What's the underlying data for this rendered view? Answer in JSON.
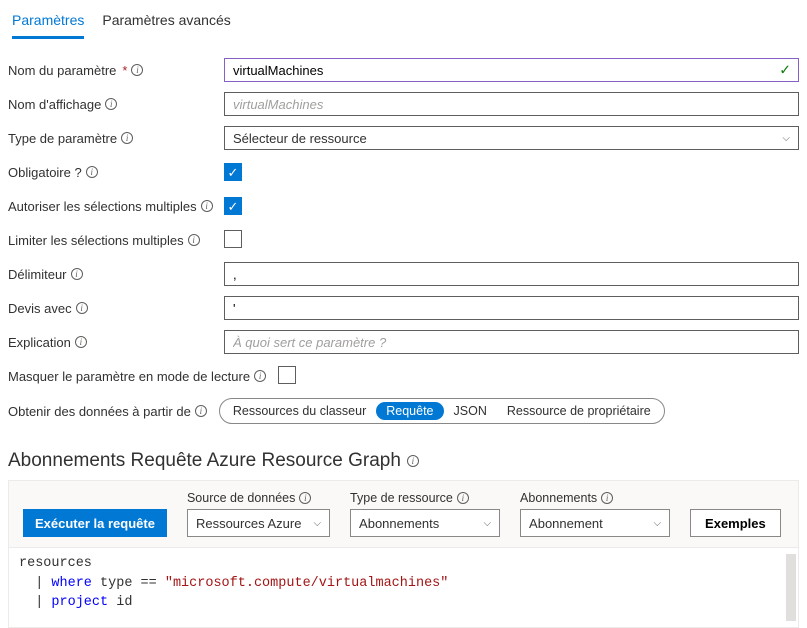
{
  "tabs": {
    "params": "Paramètres",
    "advanced": "Paramètres avancés"
  },
  "labels": {
    "param_name": "Nom du paramètre",
    "display_name": "Nom d'affichage",
    "param_type": "Type de paramètre",
    "required": "Obligatoire ?",
    "allow_multi": "Autoriser les sélections multiples",
    "limit_multi": "Limiter les sélections multiples",
    "delimiter": "Délimiteur",
    "quote_with": "Devis avec",
    "explanation": "Explication",
    "hide_read": "Masquer le paramètre en mode de lecture",
    "get_data_from": "Obtenir des données à partir de"
  },
  "values": {
    "param_name": "virtualMachines",
    "display_name_ph": "virtualMachines",
    "param_type": "Sélecteur de ressource",
    "required": true,
    "allow_multi": true,
    "limit_multi": false,
    "delimiter": ",",
    "quote_with": "'",
    "explanation_ph": "À quoi sert ce paramètre ?",
    "hide_read": false
  },
  "data_source_pills": {
    "workbook": "Ressources du classeur",
    "query": "Requête",
    "json": "JSON",
    "owner": "Ressource de propriétaire"
  },
  "section_title": "Abonnements Requête Azure Resource Graph",
  "query_toolbar": {
    "run": "Exécuter la requête",
    "data_source_label": "Source de données",
    "data_source_value": "Ressources Azure",
    "resource_type_label": "Type de ressource",
    "resource_type_value": "Abonnements",
    "subscriptions_label": "Abonnements",
    "subscriptions_value": "Abonnement",
    "examples": "Exemples"
  },
  "code": {
    "l1": "resources",
    "l2a": "| ",
    "l2b": "where",
    "l2c": " type == ",
    "l2d": "\"microsoft.compute/virtualmachines\"",
    "l3a": "| ",
    "l3b": "project",
    "l3c": " id"
  }
}
